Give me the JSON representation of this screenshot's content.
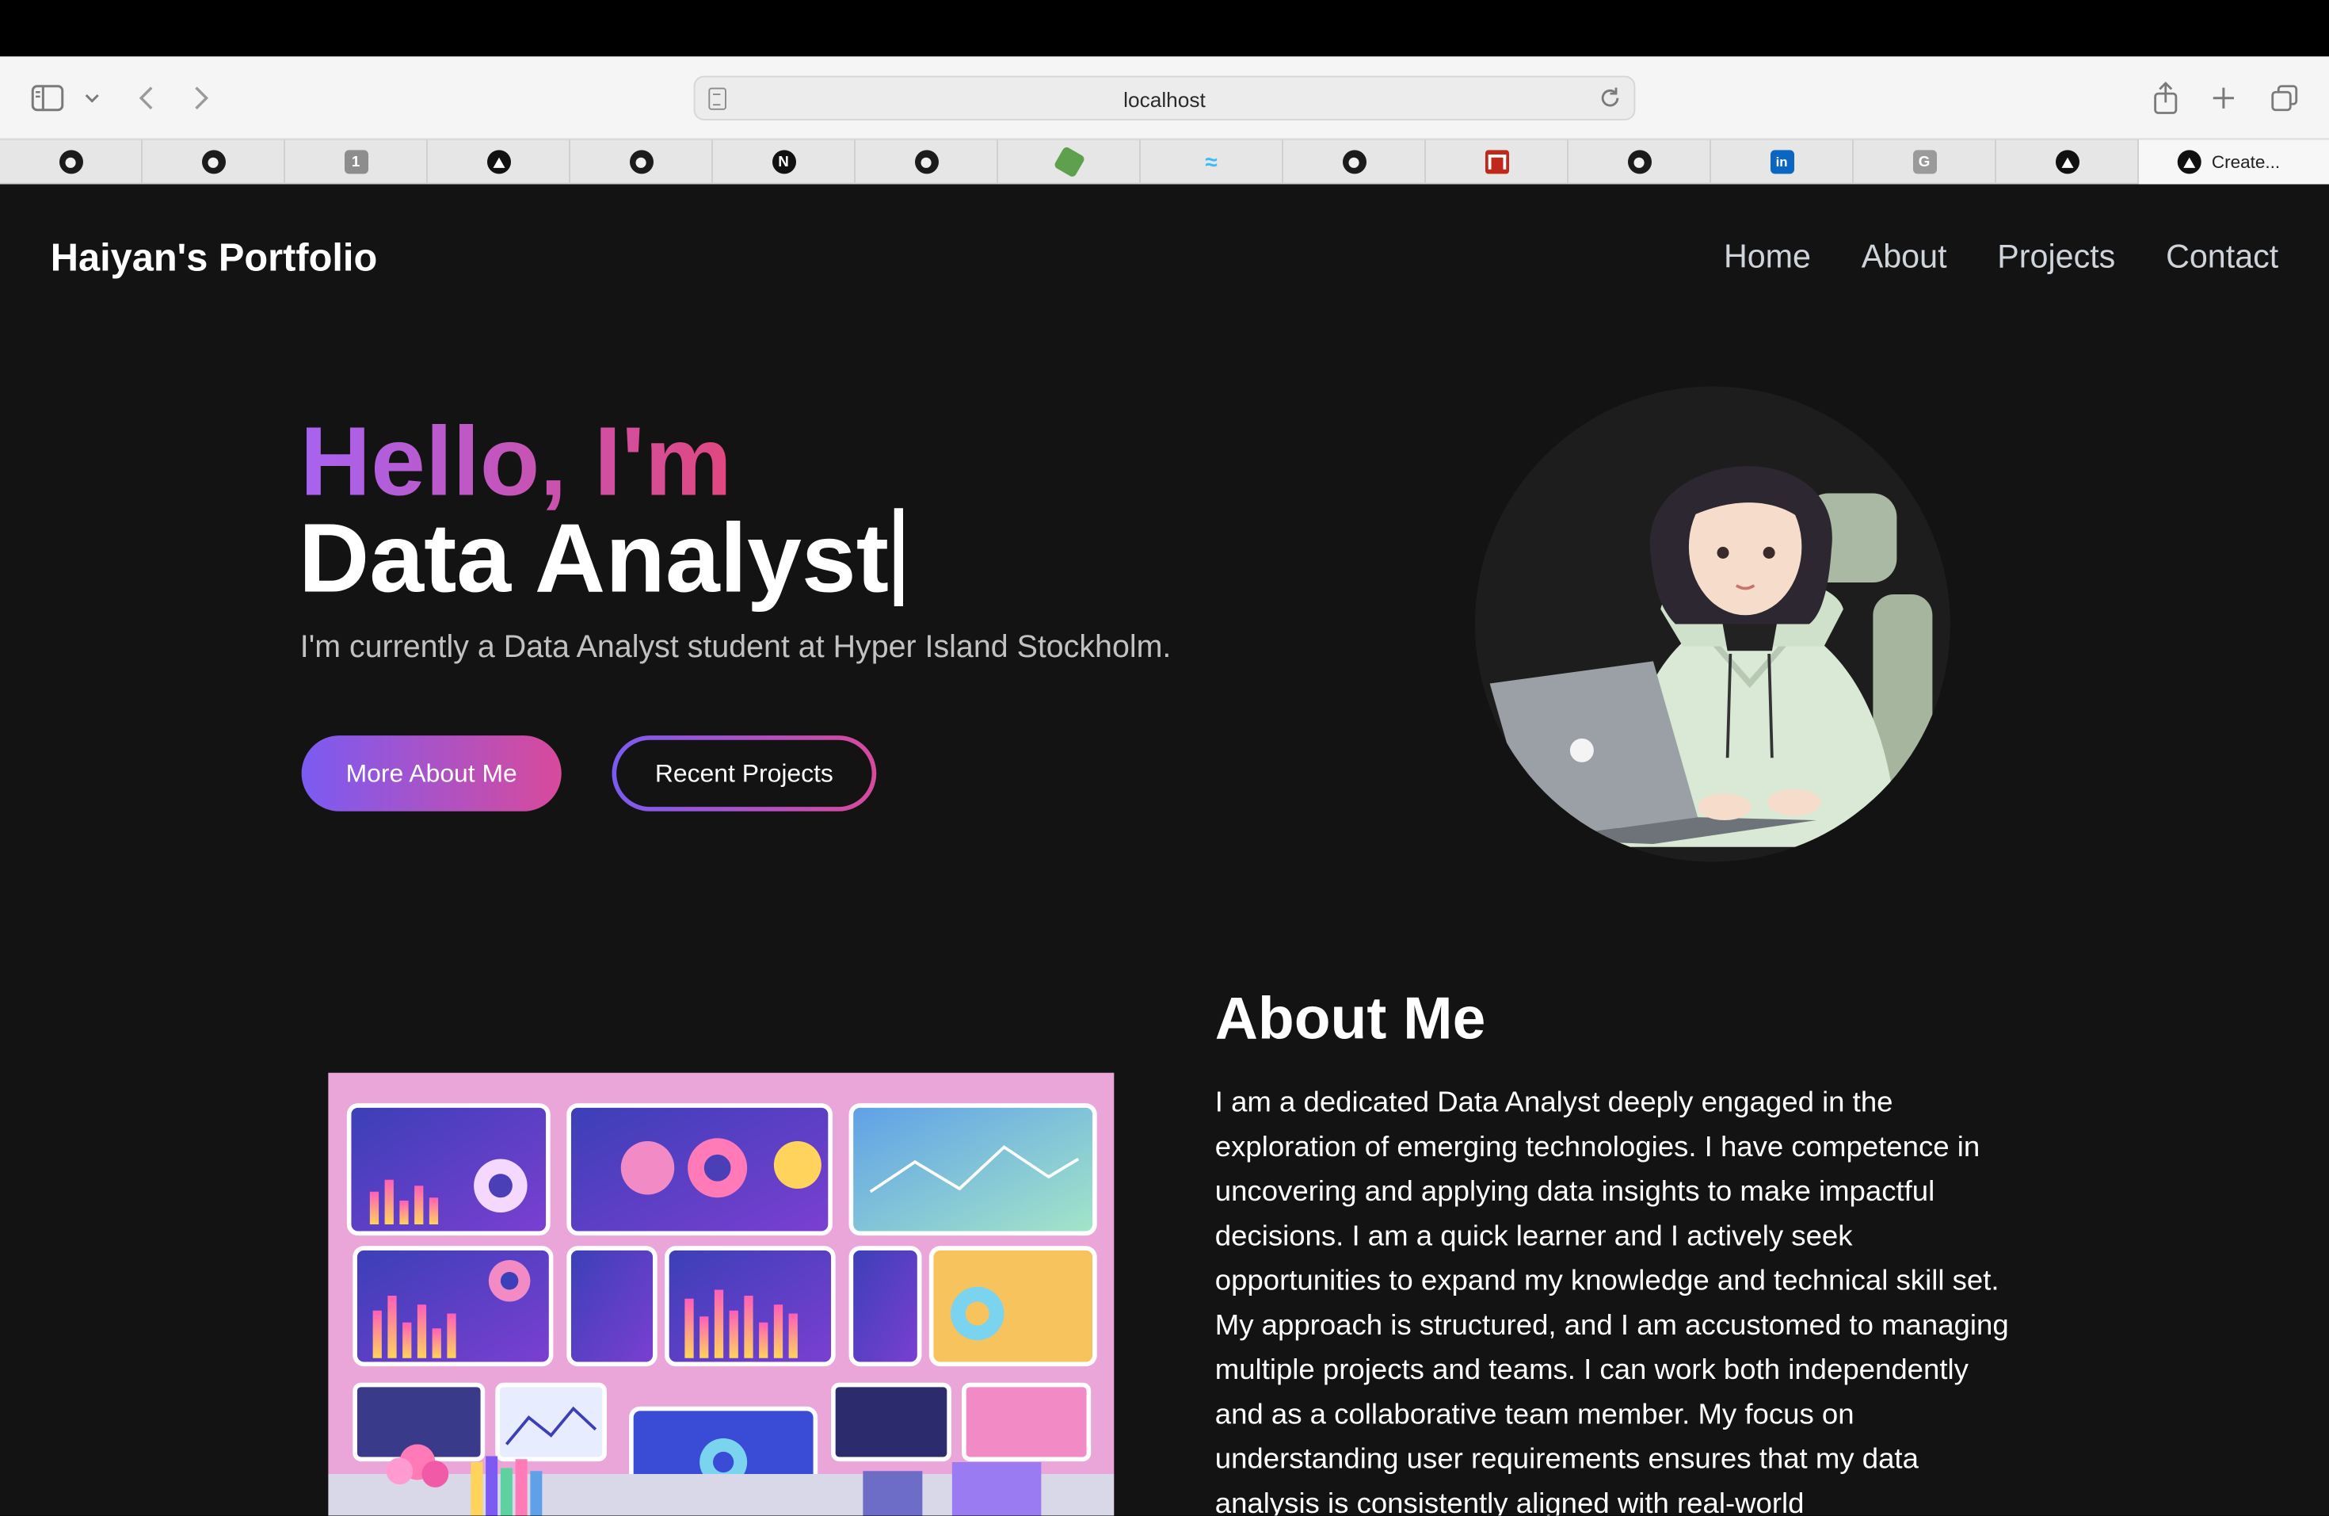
{
  "browser": {
    "url": "localhost",
    "tabs": [
      {
        "icon": "github-icon"
      },
      {
        "icon": "github-icon"
      },
      {
        "icon": "one-password-icon",
        "glyph": "1"
      },
      {
        "icon": "vercel-icon"
      },
      {
        "icon": "github-icon"
      },
      {
        "icon": "nextjs-icon",
        "glyph": "N"
      },
      {
        "icon": "github-icon"
      },
      {
        "icon": "nodejs-icon"
      },
      {
        "icon": "tailwind-icon",
        "glyph": "≈"
      },
      {
        "icon": "github-icon"
      },
      {
        "icon": "red-app-icon"
      },
      {
        "icon": "github-icon"
      },
      {
        "icon": "linkedin-icon",
        "glyph": "in"
      },
      {
        "icon": "grammarly-icon",
        "glyph": "G"
      },
      {
        "icon": "vercel-icon"
      }
    ],
    "active_tab": {
      "icon": "vercel-icon",
      "title": "Create..."
    }
  },
  "site": {
    "brand": "Haiyan's Portfolio",
    "nav": [
      "Home",
      "About",
      "Projects",
      "Contact"
    ]
  },
  "hero": {
    "greeting": "Hello, I'm",
    "role": "Data Analyst",
    "subtitle": "I'm currently a Data Analyst student at Hyper Island Stockholm.",
    "primary_button": "More About Me",
    "secondary_button": "Recent Projects",
    "avatar_icon": "illustrated-avatar-with-laptop"
  },
  "about": {
    "title": "About Me",
    "text": "I am a dedicated Data Analyst deeply engaged in the exploration of emerging technologies. I have competence in uncovering and applying data insights to make impactful decisions. I am a quick learner and I actively seek opportunities to expand my knowledge and technical skill set. My approach is structured, and I am accustomed to managing multiple projects and teams. I can work both independently and as a collaborative team member. My focus on understanding user requirements ensures that my data analysis is consistently aligned with real-world",
    "image_icon": "dashboard-illustration"
  },
  "colors": {
    "gradient_start": "#7b5bf2",
    "gradient_end": "#d84a9b",
    "page_background": "#131313"
  }
}
